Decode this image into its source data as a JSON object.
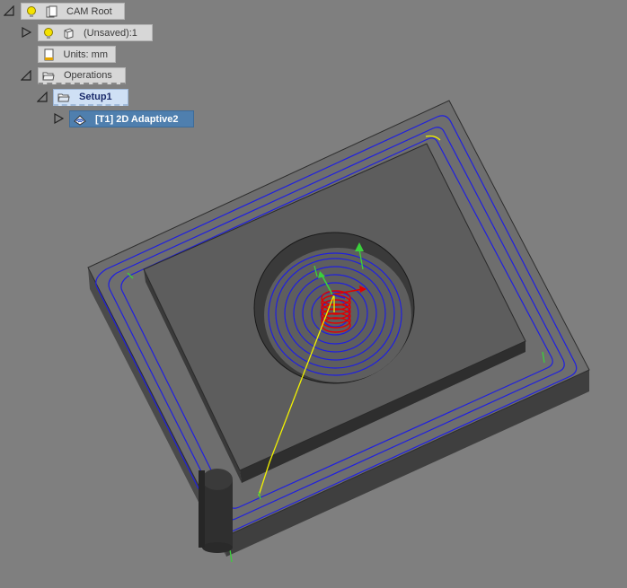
{
  "tree": {
    "cam_root": {
      "label": "CAM Root"
    },
    "model": {
      "label": "(Unsaved):1"
    },
    "units": {
      "label": "Units: mm"
    },
    "operations": {
      "label": "Operations"
    },
    "setup": {
      "label": "Setup1"
    },
    "operation": {
      "label": "[T1] 2D Adaptive2"
    }
  },
  "colors": {
    "background": "#7f7f7f",
    "stock_top": "#6e6e6e",
    "boss_top": "#5d5d5d",
    "toolpath": "#1f1fe0",
    "link_move": "#f2f200",
    "retract": "#3bd13b",
    "helix": "#e00000",
    "tool": "#2f2f2f",
    "selection": "#4f7fae"
  },
  "icons": {
    "visibility": "lightbulb-icon",
    "document": "document-icon",
    "body": "body-cube-icon",
    "units": "units-icon",
    "folder": "folder-icon",
    "setup": "setup-icon",
    "adaptive": "adaptive-operation-icon"
  }
}
